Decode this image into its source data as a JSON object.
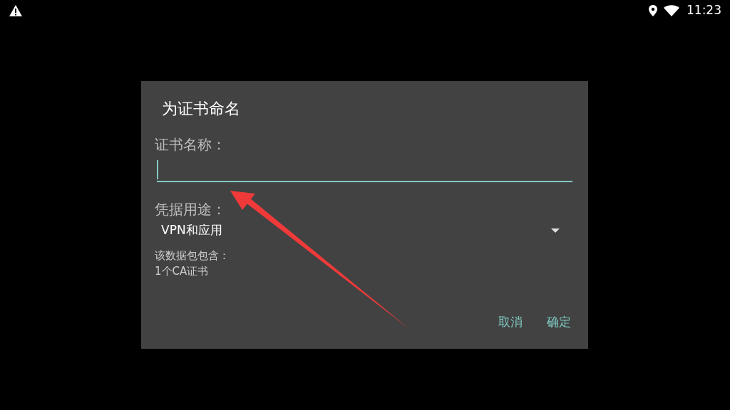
{
  "status_bar": {
    "time": "11:23"
  },
  "dialog": {
    "title": "为证书命名",
    "name_field": {
      "label": "证书名称：",
      "focused": true
    },
    "usage": {
      "label": "凭据用途：",
      "value": "VPN和应用"
    },
    "contents": {
      "label": "该数据包包含：",
      "items": [
        "1个CA证书"
      ]
    },
    "buttons": [
      "取消",
      "确定"
    ]
  }
}
